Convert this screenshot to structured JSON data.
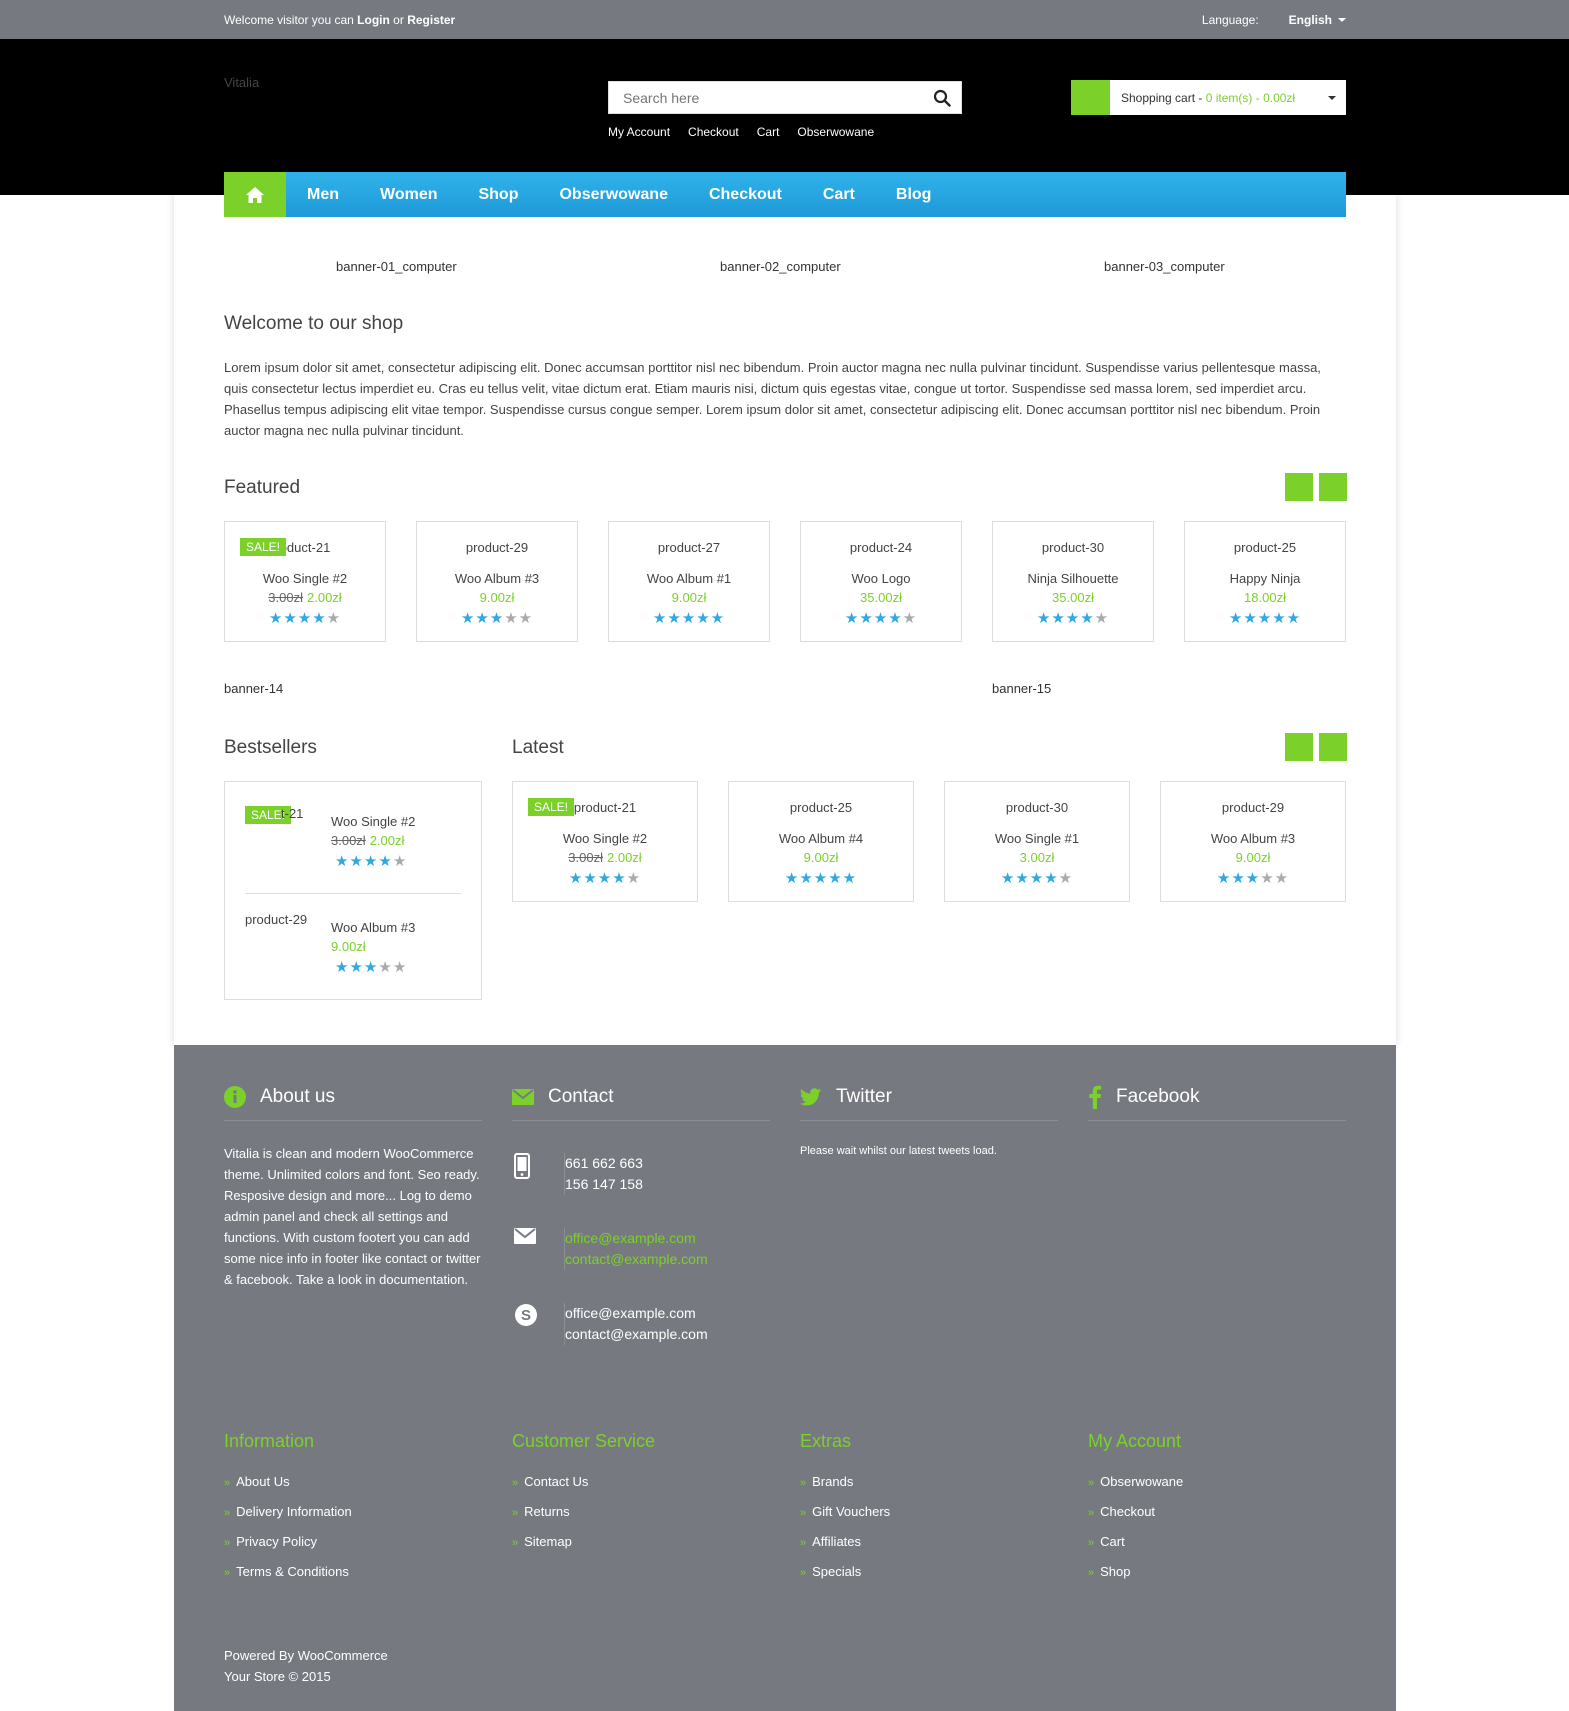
{
  "topbar": {
    "welcome_pre": "Welcome visitor you can",
    "login": "Login",
    "or": "or",
    "register": "Register",
    "language_label": "Language:",
    "language_value": "English"
  },
  "header": {
    "logo": "Vitalia",
    "search_placeholder": "Search here",
    "quick_links": [
      "My Account",
      "Checkout",
      "Cart",
      "Obserwowane"
    ],
    "cart_label": "Shopping cart -",
    "cart_info": "0 item(s) - 0.00zł"
  },
  "nav": {
    "items": [
      "Men",
      "Women",
      "Shop",
      "Obserwowane",
      "Checkout",
      "Cart",
      "Blog"
    ]
  },
  "banners": [
    "banner-01_computer",
    "banner-02_computer",
    "banner-03_computer"
  ],
  "welcome": {
    "title": "Welcome to our shop",
    "text": "Lorem ipsum dolor sit amet, consectetur adipiscing elit. Donec accumsan porttitor nisl nec bibendum. Proin auctor magna nec nulla pulvinar tincidunt. Suspendisse varius pellentesque massa, quis consectetur lectus imperdiet eu. Cras eu tellus velit, vitae dictum erat. Etiam mauris nisi, dictum quis egestas vitae, congue ut tortor. Suspendisse sed massa lorem, sed imperdiet arcu. Phasellus tempus adipiscing elit vitae tempor. Suspendisse cursus congue semper. Lorem ipsum dolor sit amet, consectetur adipiscing elit. Donec accumsan porttitor nisl nec bibendum. Proin auctor magna nec nulla pulvinar tincidunt."
  },
  "sale_label": "SALE!",
  "featured": {
    "title": "Featured",
    "products": [
      {
        "img": "oduct-21",
        "name": "Woo Single #2",
        "old": "3.00zł",
        "price": "2.00zł",
        "rating": 4,
        "sale": true
      },
      {
        "img": "product-29",
        "name": "Woo Album #3",
        "old": "",
        "price": "9.00zł",
        "rating": 3,
        "sale": false
      },
      {
        "img": "product-27",
        "name": "Woo Album #1",
        "old": "",
        "price": "9.00zł",
        "rating": 5,
        "sale": false
      },
      {
        "img": "product-24",
        "name": "Woo Logo",
        "old": "",
        "price": "35.00zł",
        "rating": 4,
        "sale": false
      },
      {
        "img": "product-30",
        "name": "Ninja Silhouette",
        "old": "",
        "price": "35.00zł",
        "rating": 4,
        "sale": false
      },
      {
        "img": "product-25",
        "name": "Happy Ninja",
        "old": "",
        "price": "18.00zł",
        "rating": 5,
        "sale": false
      }
    ]
  },
  "mid_banners": [
    "banner-14",
    "banner-15"
  ],
  "bestsellers": {
    "title": "Bestsellers",
    "products": [
      {
        "img": "t-21",
        "name": "Woo Single #2",
        "old": "3.00zł",
        "price": "2.00zł",
        "rating": 4,
        "sale": true
      },
      {
        "img": "product-29",
        "name": "Woo Album #3",
        "old": "",
        "price": "9.00zł",
        "rating": 3,
        "sale": false
      }
    ]
  },
  "latest": {
    "title": "Latest",
    "products": [
      {
        "img": "product-21",
        "name": "Woo Single #2",
        "old": "3.00zł",
        "price": "2.00zł",
        "rating": 4,
        "sale": true
      },
      {
        "img": "product-25",
        "name": "Woo Album #4",
        "old": "",
        "price": "9.00zł",
        "rating": 5,
        "sale": false
      },
      {
        "img": "product-30",
        "name": "Woo Single #1",
        "old": "",
        "price": "3.00zł",
        "rating": 4,
        "sale": false
      },
      {
        "img": "product-29",
        "name": "Woo Album #3",
        "old": "",
        "price": "9.00zł",
        "rating": 3,
        "sale": false
      }
    ]
  },
  "footer": {
    "about_title": "About us",
    "about_text": "Vitalia is clean and modern WooCommerce theme. Unlimited colors and font. Seo ready. Resposive design and more... Log to demo admin panel and check all settings and functions. With custom footert you can add some nice info in footer like contact or twitter & facebook. Take a look in documentation.",
    "contact_title": "Contact",
    "phones": [
      "661 662 663",
      "156 147 158"
    ],
    "emails": [
      "office@example.com",
      "contact@example.com"
    ],
    "skype": [
      "office@example.com",
      "contact@example.com"
    ],
    "twitter_title": "Twitter",
    "twitter_text": "Please wait whilst our latest tweets load.",
    "facebook_title": "Facebook",
    "info_title": "Information",
    "info_links": [
      "About Us",
      "Delivery Information",
      "Privacy Policy",
      "Terms & Conditions"
    ],
    "service_title": "Customer Service",
    "service_links": [
      "Contact Us",
      "Returns",
      "Sitemap"
    ],
    "extras_title": "Extras",
    "extras_links": [
      "Brands",
      "Gift Vouchers",
      "Affiliates",
      "Specials"
    ],
    "account_title": "My Account",
    "account_links": [
      "Obserwowane",
      "Checkout",
      "Cart",
      "Shop"
    ],
    "powered": "Powered By WooCommerce",
    "copyright": "Your Store © 2015"
  },
  "colors": {
    "accent_green": "#7bd02a",
    "nav_blue": "#2aa8e4",
    "star_blue": "#2fa9df",
    "footer_gray": "#767a80"
  }
}
